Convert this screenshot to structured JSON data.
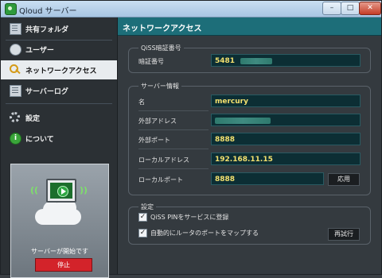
{
  "window": {
    "title": "Qloud サーバー",
    "min": "–",
    "max": "□",
    "close": "✕"
  },
  "sidebar": {
    "items": [
      {
        "label": "共有フォルダ",
        "icon": "folder-icon"
      },
      {
        "label": "ユーザー",
        "icon": "user-icon"
      },
      {
        "label": "ネットワークアクセス",
        "icon": "key-icon",
        "active": true
      },
      {
        "label": "サーバーログ",
        "icon": "log-icon"
      },
      {
        "label": "設定",
        "icon": "gear-icon"
      },
      {
        "label": "について",
        "icon": "info-icon"
      }
    ],
    "info_glyph": "i",
    "status": {
      "text": "サーバーが開始です",
      "stop_button": "停止",
      "wave_left": "((",
      "wave_right": "))"
    }
  },
  "main": {
    "title": "ネットワークアクセス",
    "pin_group": {
      "title": "QiSS暗証番号",
      "label": "暗証番号",
      "value": "5481"
    },
    "server_group": {
      "title": "サーバー情報",
      "name_label": "名",
      "name_value": "mercury",
      "external_address_label": "外部アドレス",
      "external_address_value": "",
      "external_port_label": "外部ポート",
      "external_port_value": "8888",
      "local_address_label": "ローカルアドレス",
      "local_address_value": "192.168.11.15",
      "local_port_label": "ローカルポート",
      "local_port_value": "8888",
      "apply_button": "応用"
    },
    "settings_group": {
      "title": "設定",
      "register_pin_label": "QiSS PINをサービスに登録",
      "register_pin_checked": true,
      "auto_map_label": "自動的にルータのポートをマップする",
      "auto_map_checked": true,
      "retry_button": "再試行",
      "check_glyph": "✓"
    }
  },
  "colors": {
    "header": "#1d6e79",
    "field_text": "#f3e06e",
    "stop": "#d3232a",
    "active_bg": "#e8ecef"
  }
}
